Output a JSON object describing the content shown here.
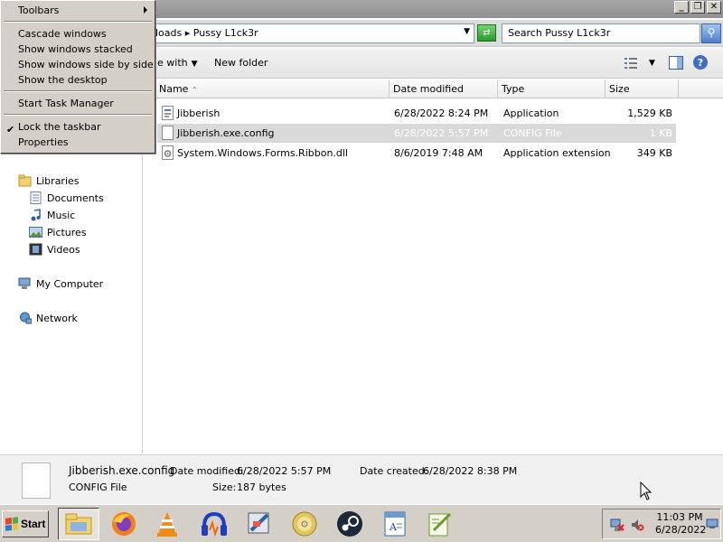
{
  "explorer": {
    "breadcrumb": "loads ▸ Pussy L1ck3r",
    "search_placeholder": "Search Pussy L1ck3r",
    "toolbar": {
      "open_with": "e with",
      "new_folder": "New folder"
    },
    "columns": [
      "Name",
      "Date modified",
      "Type",
      "Size"
    ],
    "files": [
      {
        "name": "Jibberish",
        "date": "6/28/2022 8:24 PM",
        "type": "Application",
        "size": "1,529 KB"
      },
      {
        "name": "Jibberish.exe.config",
        "date": "6/28/2022 5:57 PM",
        "type": "CONFIG File",
        "size": "1 KB"
      },
      {
        "name": "System.Windows.Forms.Ribbon.dll",
        "date": "8/6/2019 7:48 AM",
        "type": "Application extension",
        "size": "349 KB"
      }
    ],
    "nav": {
      "libraries": "Libraries",
      "documents": "Documents",
      "music": "Music",
      "pictures": "Pictures",
      "videos": "Videos",
      "my_computer": "My Computer",
      "network": "Network"
    },
    "details": {
      "filename": "Jibberish.exe.config",
      "date_modified_label": "Date modified:",
      "date_modified": "6/28/2022 5:57 PM",
      "date_created_label": "Date created:",
      "date_created": "6/28/2022 8:38 PM",
      "type": "CONFIG File",
      "size_label": "Size:",
      "size": "187 bytes"
    }
  },
  "context_menu": {
    "toolbars": "Toolbars",
    "cascade": "Cascade windows",
    "stacked": "Show windows stacked",
    "side_by_side": "Show windows side by side",
    "desktop": "Show the desktop",
    "task_manager": "Start Task Manager",
    "lock_taskbar": "Lock the taskbar",
    "lock_checked": "✔",
    "properties": "Properties"
  },
  "taskbar": {
    "start_label": "Start",
    "clock_time": "11:03 PM",
    "clock_date": "6/28/2022",
    "quick_launch": [
      "folder-icon",
      "firefox-icon",
      "vlc-icon",
      "audacity-icon",
      "paint-icon",
      "disc-icon",
      "steam-icon",
      "wordpad-icon",
      "notepadplusplus-icon"
    ]
  },
  "colors": {
    "selection": "#d9d9d9",
    "accent": "#3a64a0",
    "taskbar": "#d4d0c8"
  }
}
